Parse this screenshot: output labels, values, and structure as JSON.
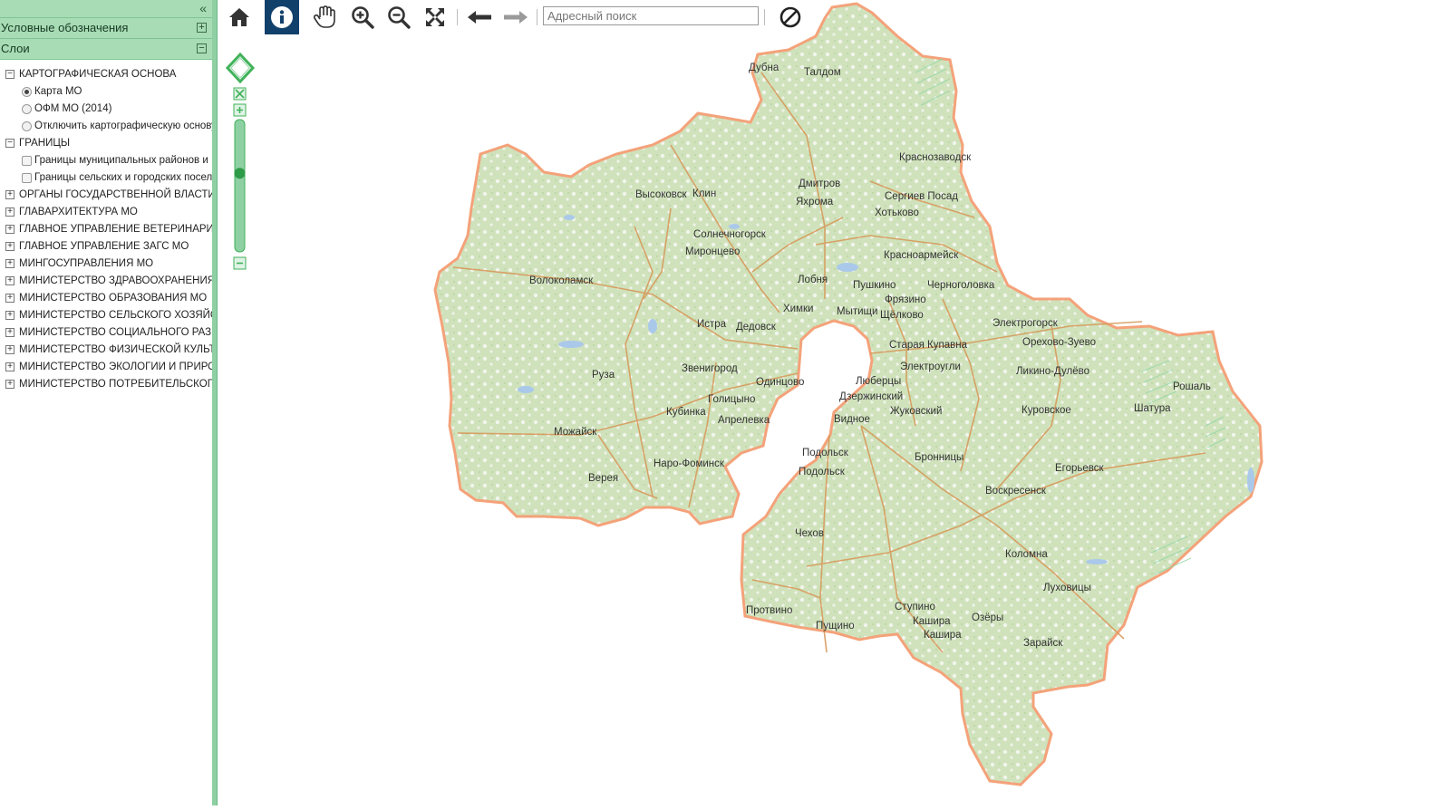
{
  "sidebar": {
    "collapse_icon": "double-chevron-left-icon",
    "legend_header": "Условные обозначения",
    "legend_toggle": "⊞",
    "layers_header": "Слои",
    "layers_toggle": "⊟",
    "groups": [
      {
        "label": "КАРТОГРАФИЧЕСКАЯ ОСНОВА",
        "expanded": true,
        "items": [
          {
            "type": "radio",
            "label": "Карта МО",
            "checked": true
          },
          {
            "type": "radio",
            "label": "ОФМ МО (2014)",
            "checked": false
          },
          {
            "type": "radio",
            "label": "Отключить картографическую основу",
            "checked": false
          }
        ]
      },
      {
        "label": "ГРАНИЦЫ",
        "expanded": true,
        "items": [
          {
            "type": "checkbox",
            "label": "Границы муниципальных районов и",
            "checked": false
          },
          {
            "type": "checkbox",
            "label": "Границы сельских и городских посел",
            "checked": false
          }
        ]
      },
      {
        "label": "ОРГАНЫ ГОСУДАРСТВЕННОЙ ВЛАСТИ МО",
        "expanded": false
      },
      {
        "label": "ГЛАВАРХИТЕКТУРА МО",
        "expanded": false
      },
      {
        "label": "ГЛАВНОЕ УПРАВЛЕНИЕ ВЕТЕРИНАРИИ",
        "expanded": false
      },
      {
        "label": "ГЛАВНОЕ УПРАВЛЕНИЕ ЗАГС МО",
        "expanded": false
      },
      {
        "label": "МИНГОСУПРАВЛЕНИЯ МО",
        "expanded": false
      },
      {
        "label": "МИНИСТЕРСТВО ЗДРАВООХРАНЕНИЯ МО",
        "expanded": false
      },
      {
        "label": "МИНИСТЕРСТВО ОБРАЗОВАНИЯ МО",
        "expanded": false
      },
      {
        "label": "МИНИСТЕРСТВО СЕЛЬСКОГО ХОЗЯЙСТВА",
        "expanded": false
      },
      {
        "label": "МИНИСТЕРСТВО СОЦИАЛЬНОГО РАЗВИТИЯ",
        "expanded": false
      },
      {
        "label": "МИНИСТЕРСТВО ФИЗИЧЕСКОЙ КУЛЬТУРЫ",
        "expanded": false
      },
      {
        "label": "МИНИСТЕРСТВО ЭКОЛОГИИ И ПРИРОДОПОЛЬЗОВАНИЯ",
        "expanded": false
      },
      {
        "label": "МИНИСТЕРСТВО ПОТРЕБИТЕЛЬСКОГО РЫНКА",
        "expanded": false
      }
    ]
  },
  "toolbar": {
    "buttons": [
      {
        "name": "home-button",
        "icon": "home-icon"
      },
      {
        "name": "info-button",
        "icon": "info-icon",
        "active": true
      },
      {
        "name": "pan-button",
        "icon": "hand-icon"
      },
      {
        "name": "zoom-in-button",
        "icon": "zoom-in-icon"
      },
      {
        "name": "zoom-out-button",
        "icon": "zoom-out-icon"
      },
      {
        "name": "full-extent-button",
        "icon": "expand-arrows-icon"
      },
      {
        "name": "back-button",
        "icon": "arrow-left-icon"
      },
      {
        "name": "forward-button",
        "icon": "arrow-right-icon"
      },
      {
        "name": "clear-button",
        "icon": "prohibited-icon"
      }
    ],
    "search_placeholder": "Адресный поиск"
  },
  "zoom": {
    "level_fraction": 0.6
  },
  "map": {
    "fill_color": "#d4e5c2",
    "border_color": "#f2a77f",
    "road_color": "#d99a5c",
    "water_color": "#a8c8e8",
    "cities": [
      "Дубна",
      "Талдом",
      "Краснозаводск",
      "Дмитров",
      "Высоковск",
      "Клин",
      "Сергиев Посад",
      "Яхрома",
      "Хотьково",
      "Солнечногорск",
      "Миронцево",
      "Красноармейск",
      "Волоколамск",
      "Лобня",
      "Пушкино",
      "Черноголовка",
      "Фрязино",
      "Химки",
      "Мытищи",
      "Щёлково",
      "Истра",
      "Дедовск",
      "Электрогорск",
      "Старая Купавна",
      "Орехово-Зуево",
      "Электроугли",
      "Ликино-Дулёво",
      "Руза",
      "Звенигород",
      "Одинцово",
      "Люберцы",
      "Голицыно",
      "Дзержинский",
      "Рошаль",
      "Шатура",
      "Кубинка",
      "Апрелевка",
      "Жуковский",
      "Куровское",
      "Видное",
      "Можайск",
      "Подольск",
      "Бронницы",
      "Наро-Фоминск",
      "Верея",
      "Егорьевск",
      "Воскресенск",
      "Чехов",
      "Коломна",
      "Луховицы",
      "Ступино",
      "Протвино",
      "Кашира",
      "Озёры",
      "Пущино",
      "Зарайск"
    ]
  }
}
